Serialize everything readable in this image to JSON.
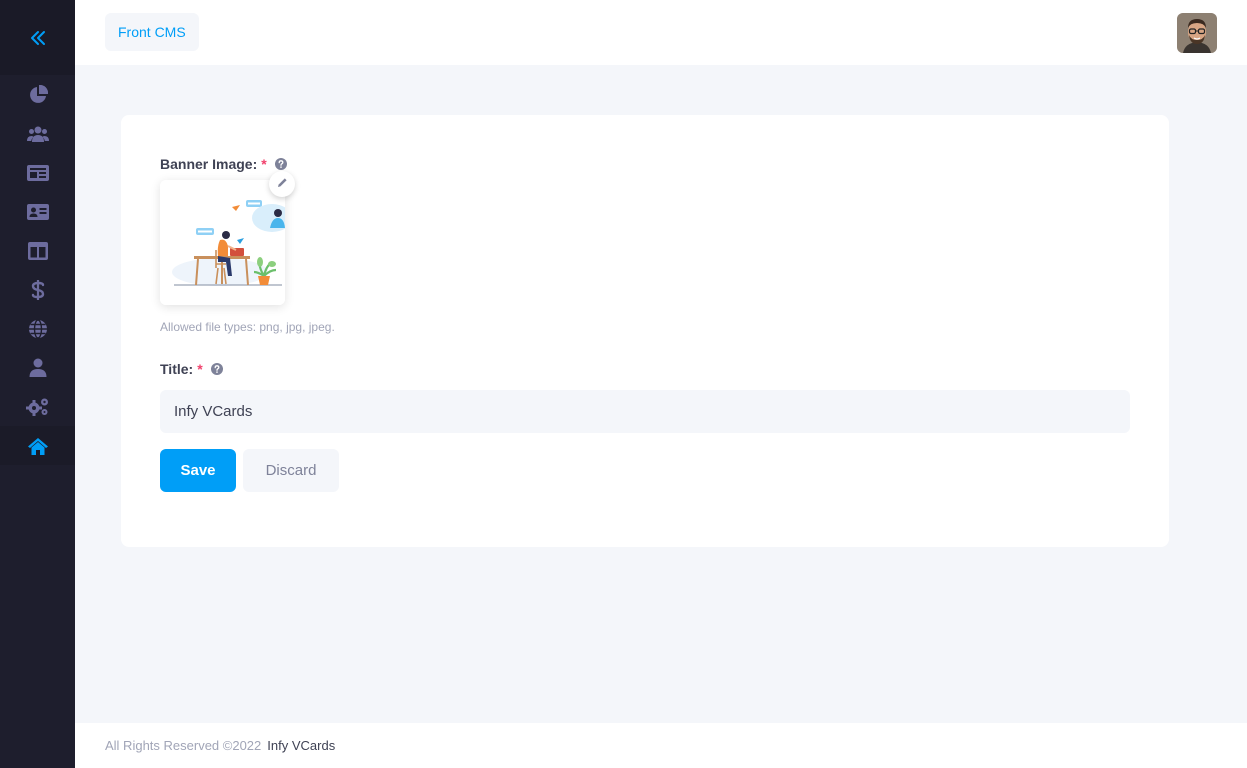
{
  "colors": {
    "accent": "#009ef7",
    "sidebar_bg": "#1e1e2d",
    "nav_icon": "#6d6c9e",
    "required": "#f1416c"
  },
  "sidebar": {
    "collapse_icon": "double-chevron-left-icon",
    "items": [
      {
        "icon": "pie-chart-icon",
        "active": false
      },
      {
        "icon": "users-icon",
        "active": false
      },
      {
        "icon": "vcard-icon",
        "active": false
      },
      {
        "icon": "id-card-icon",
        "active": false
      },
      {
        "icon": "layout-icon",
        "active": false
      },
      {
        "icon": "dollar-icon",
        "active": false
      },
      {
        "icon": "globe-icon",
        "active": false
      },
      {
        "icon": "user-icon",
        "active": false
      },
      {
        "icon": "cogs-icon",
        "active": false
      },
      {
        "icon": "home-icon",
        "active": true
      }
    ]
  },
  "header": {
    "breadcrumb": "Front CMS",
    "avatar_icon": "user-avatar"
  },
  "form": {
    "banner_label": "Banner Image:",
    "required_mark": "*",
    "allowed_types": "Allowed file types: png, jpg, jpeg.",
    "title_label": "Title:",
    "title_value": "Infy VCards",
    "save_label": "Save",
    "discard_label": "Discard"
  },
  "footer": {
    "copyright": "All Rights Reserved ©2022",
    "brand": "Infy VCards"
  }
}
